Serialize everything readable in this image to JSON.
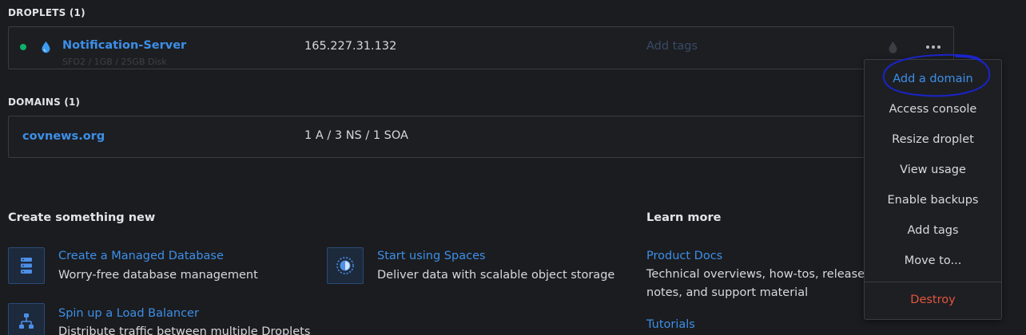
{
  "droplets_section": {
    "title": "DROPLETS (1)",
    "droplet": {
      "name": "Notification-Server",
      "specs": "SFO2 / 1GB / 25GB Disk",
      "ip": "165.227.31.132",
      "tags_placeholder": "Add tags",
      "status_color": "#0db06a"
    }
  },
  "domains_section": {
    "title": "DOMAINS (1)",
    "domain": {
      "name": "covnews.org",
      "records": "1 A / 3 NS / 1 SOA"
    }
  },
  "create_section": {
    "heading": "Create something new",
    "cards": [
      {
        "title": "Create a Managed Database",
        "desc": "Worry-free database management",
        "icon": "database-icon"
      },
      {
        "title": "Start using Spaces",
        "desc": "Deliver data with scalable object storage",
        "icon": "spaces-icon"
      },
      {
        "title": "Spin up a Load Balancer",
        "desc": "Distribute traffic between multiple Droplets",
        "icon": "load-balancer-icon"
      }
    ]
  },
  "learn_section": {
    "heading": "Learn more",
    "links": [
      {
        "title": "Product Docs",
        "desc": "Technical overviews, how-tos, release notes, and support material"
      },
      {
        "title": "Tutorials"
      }
    ]
  },
  "context_menu": {
    "items": [
      "Add a domain",
      "Access console",
      "Resize droplet",
      "View usage",
      "Enable backups",
      "Add tags",
      "Move to...",
      "Destroy"
    ]
  },
  "colors": {
    "background": "#1b1c1f",
    "link": "#3c8fe8",
    "danger": "#e2553d",
    "annotation": "#1a24c8"
  }
}
